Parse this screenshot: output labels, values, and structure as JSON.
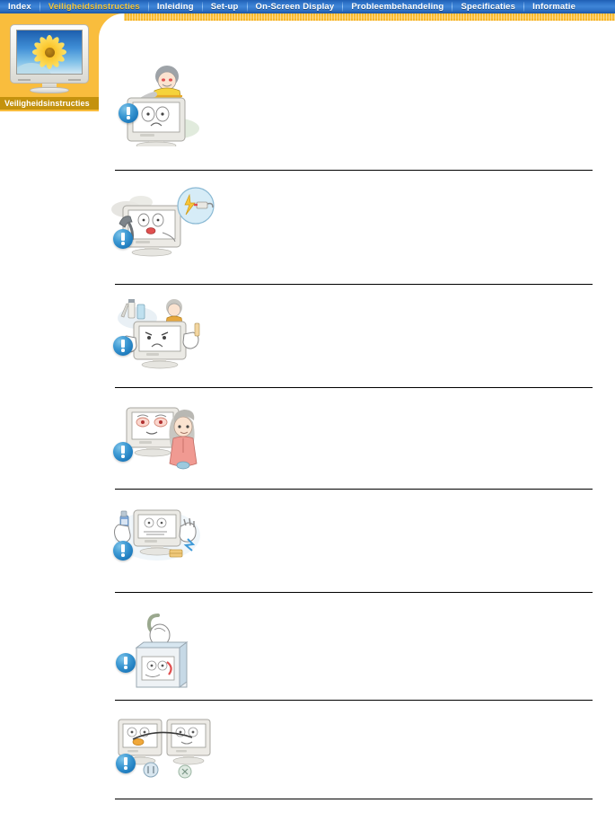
{
  "nav": {
    "tabs": [
      {
        "label": "Index",
        "active": false
      },
      {
        "label": "Veiligheidsinstructies",
        "active": true
      },
      {
        "label": "Inleiding",
        "active": false
      },
      {
        "label": "Set-up",
        "active": false
      },
      {
        "label": "On-Screen Display",
        "active": false
      },
      {
        "label": "Probleembehandeling",
        "active": false
      },
      {
        "label": "Specificaties",
        "active": false
      },
      {
        "label": "Informatie",
        "active": false
      }
    ],
    "active_color": "#f5c73c",
    "text_color": "#ffffff",
    "background_color": "#2f73c8"
  },
  "sidebar": {
    "label": "Veiligheidsinstructies",
    "label_background": "#c4920e",
    "panel_background": "#f9bd3d",
    "thumbnail": {
      "name": "monitor-sunflower-thumbnail",
      "screen_background": "#3f8ed6",
      "flower_color": "#fbc62c"
    }
  },
  "content": {
    "warning_icon_name": "blue-exclamation-icon",
    "warning_icon_color": "#1f7cbe",
    "divider_color": "#000000",
    "sections": [
      {
        "id": 1,
        "illustration": "monitor-person-behind-warning",
        "text": ""
      },
      {
        "id": 2,
        "illustration": "monitor-phone-lightning-warning",
        "text": ""
      },
      {
        "id": 3,
        "illustration": "monitor-cleaning-chemicals-warning",
        "text": ""
      },
      {
        "id": 4,
        "illustration": "monitor-tired-eyes-woman-warning",
        "text": ""
      },
      {
        "id": 5,
        "illustration": "monitor-spray-hand-warning",
        "text": ""
      },
      {
        "id": 6,
        "illustration": "monitor-lifting-box-warning",
        "text": ""
      },
      {
        "id": 7,
        "illustration": "monitor-comparison-pair-warning",
        "text": ""
      }
    ]
  }
}
